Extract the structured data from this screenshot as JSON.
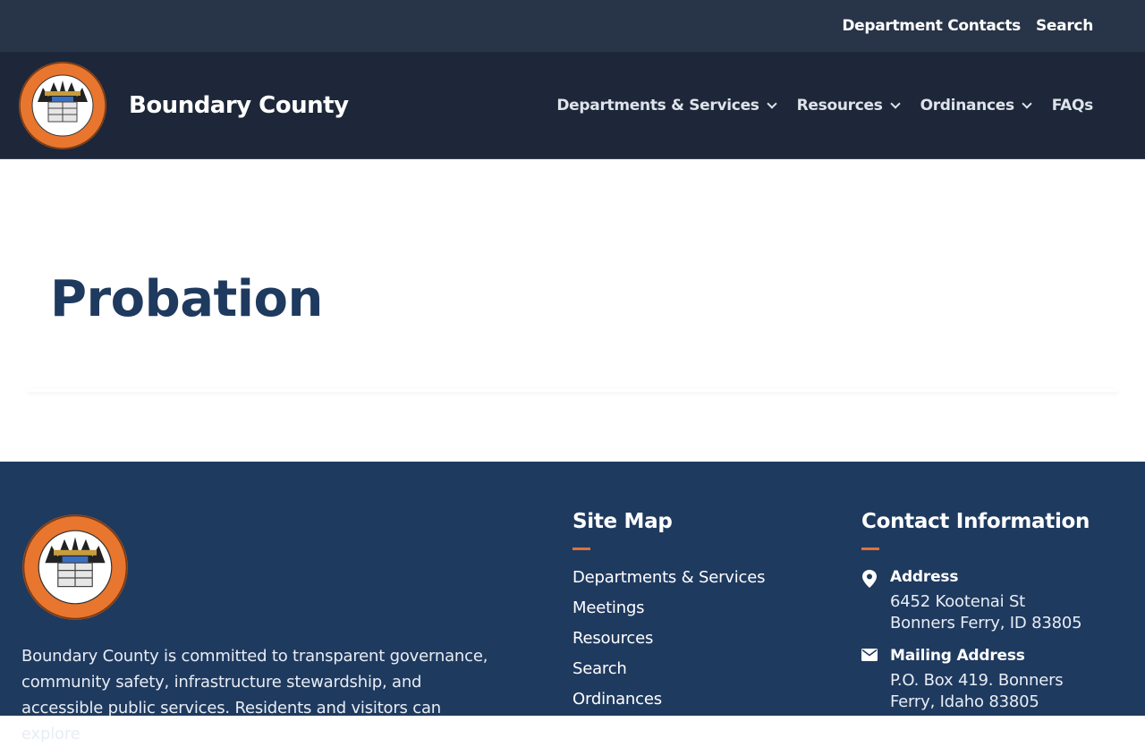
{
  "topbar": {
    "links": [
      "Department Contacts",
      "Search"
    ]
  },
  "header": {
    "site_name": "Boundary County",
    "nav": [
      {
        "label": "Departments & Services",
        "dropdown": true
      },
      {
        "label": "Resources",
        "dropdown": true
      },
      {
        "label": "Ordinances",
        "dropdown": true
      },
      {
        "label": "FAQs",
        "dropdown": false
      }
    ]
  },
  "hero": {
    "title": "Probation"
  },
  "footer": {
    "description": "Boundary County is committed to transparent governance, community safety, infrastructure stewardship, and accessible public services. Residents and visitors can explore",
    "sitemap": {
      "title": "Site Map",
      "links": [
        "Departments & Services",
        "Meetings",
        "Resources",
        "Search",
        "Ordinances"
      ]
    },
    "contact": {
      "title": "Contact Information",
      "address_label": "Address",
      "address_line1": "6452 Kootenai St",
      "address_line2": "Bonners Ferry, ID 83805",
      "mailing_label": "Mailing Address",
      "mailing_line1": "P.O. Box 419. Bonners",
      "mailing_line2": "Ferry, Idaho 83805"
    }
  },
  "colors": {
    "topbar": "#283447",
    "nav": "#1d2739",
    "footer": "#1f3a5f",
    "accent": "#e0713a",
    "title": "#1f3a5f"
  },
  "icons": {
    "seal": "county-seal-icon",
    "address": "map-pin-icon",
    "mail": "envelope-icon"
  }
}
